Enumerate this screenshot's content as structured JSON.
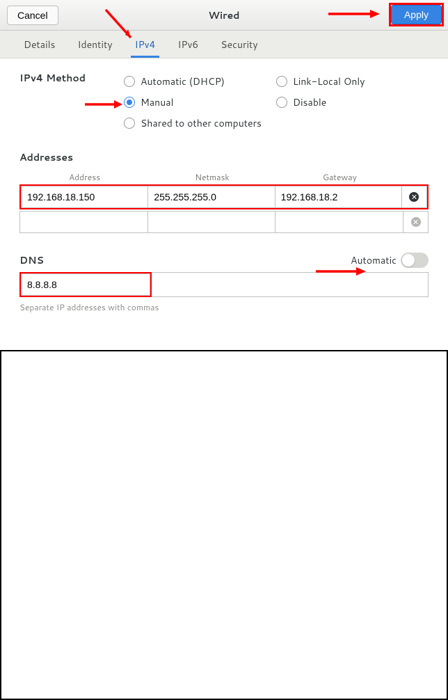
{
  "header": {
    "cancel": "Cancel",
    "title": "Wired",
    "apply": "Apply"
  },
  "tabs": [
    "Details",
    "Identity",
    "IPv4",
    "IPv6",
    "Security"
  ],
  "active_tab": "IPv4",
  "method": {
    "label": "IPv4 Method",
    "options_col1": [
      {
        "key": "auto",
        "label": "Automatic (DHCP)",
        "checked": false
      },
      {
        "key": "manual",
        "label": "Manual",
        "checked": true
      },
      {
        "key": "shared",
        "label": "Shared to other computers",
        "checked": false
      }
    ],
    "options_col2": [
      {
        "key": "linklocal",
        "label": "Link-Local Only",
        "checked": false
      },
      {
        "key": "disable",
        "label": "Disable",
        "checked": false
      }
    ]
  },
  "addresses": {
    "label": "Addresses",
    "columns": {
      "address": "Address",
      "netmask": "Netmask",
      "gateway": "Gateway"
    },
    "rows": [
      {
        "address": "192.168.18.150",
        "netmask": "255.255.255.0",
        "gateway": "192.168.18.2"
      },
      {
        "address": "",
        "netmask": "",
        "gateway": ""
      }
    ]
  },
  "dns": {
    "label": "DNS",
    "auto_label": "Automatic",
    "auto_on": false,
    "value": "8.8.8.8",
    "hint": "Separate IP addresses with commas"
  }
}
